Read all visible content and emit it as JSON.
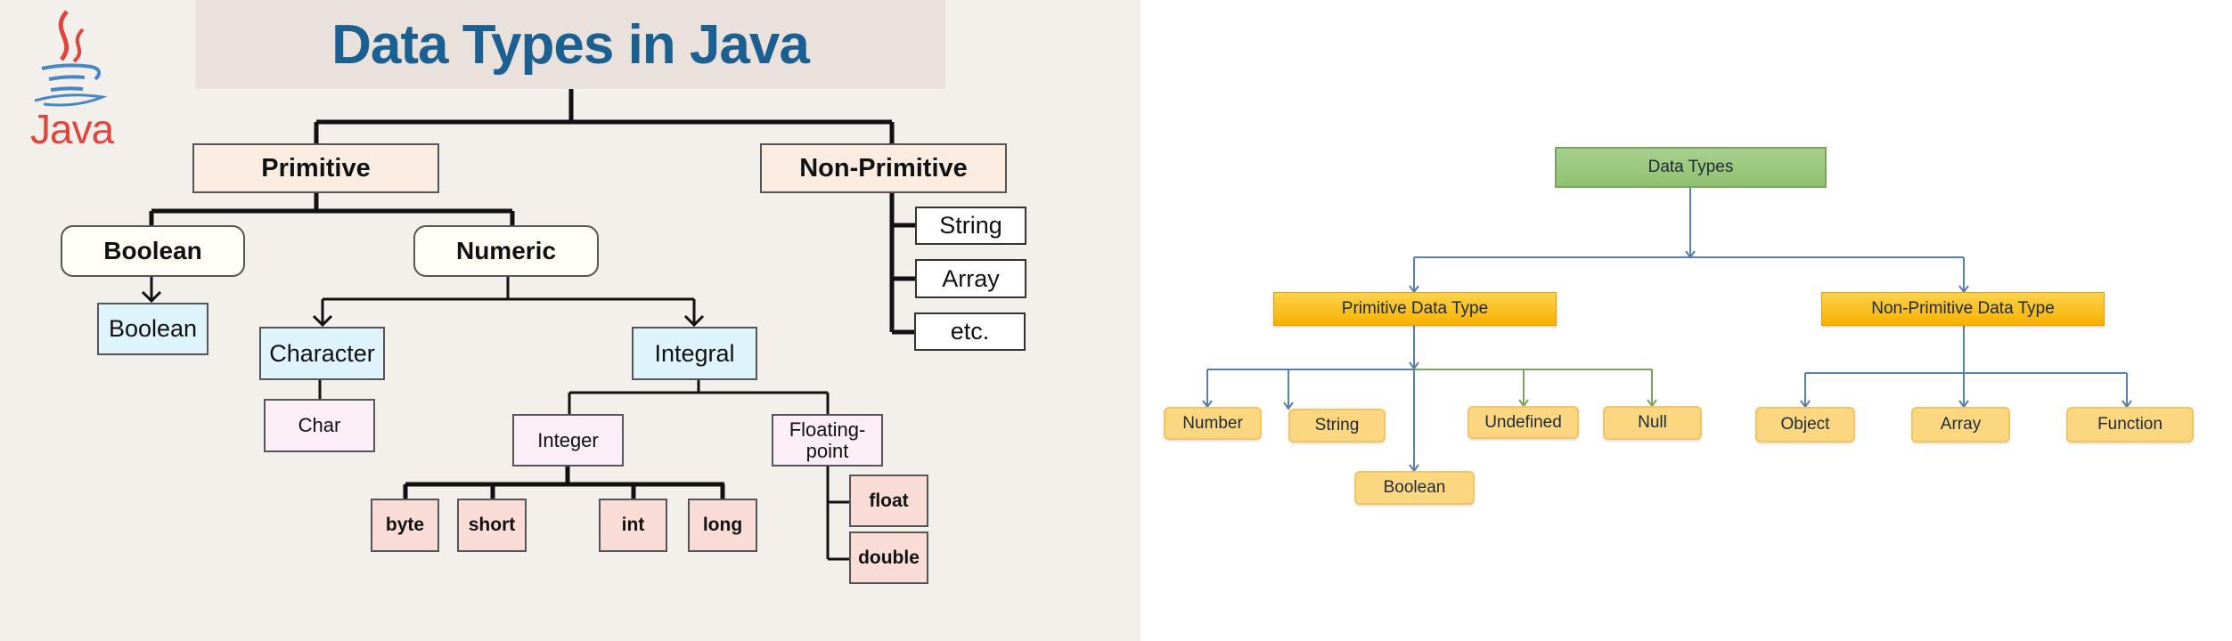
{
  "left": {
    "title": "Data Types in Java",
    "logo_text": "Java",
    "nodes": {
      "primitive": "Primitive",
      "non_primitive": "Non-Primitive",
      "boolean_category": "Boolean",
      "numeric": "Numeric",
      "boolean_type": "Boolean",
      "character": "Character",
      "integral": "Integral",
      "char": "Char",
      "integer": "Integer",
      "floating_point": "Floating-point",
      "byte": "byte",
      "short": "short",
      "int": "int",
      "long": "long",
      "float": "float",
      "double": "double",
      "string": "String",
      "array": "Array",
      "etc": "etc."
    },
    "colors": {
      "title": "#1c5f91",
      "logo": "#e0463c",
      "logo_cup": "#4a86c5"
    }
  },
  "right": {
    "nodes": {
      "root": "Data Types",
      "primitive": "Primitive Data Type",
      "non_primitive": "Non-Primitive Data Type",
      "number": "Number",
      "string": "String",
      "undefined": "Undefined",
      "null": "Null",
      "boolean": "Boolean",
      "object": "Object",
      "array": "Array",
      "function": "Function"
    },
    "colors": {
      "root": "#9dc97f",
      "category": "#ffc000",
      "leaf": "#fdd77f",
      "connector": "#5a7fa8",
      "connector_alt": "#7aa35b"
    }
  }
}
